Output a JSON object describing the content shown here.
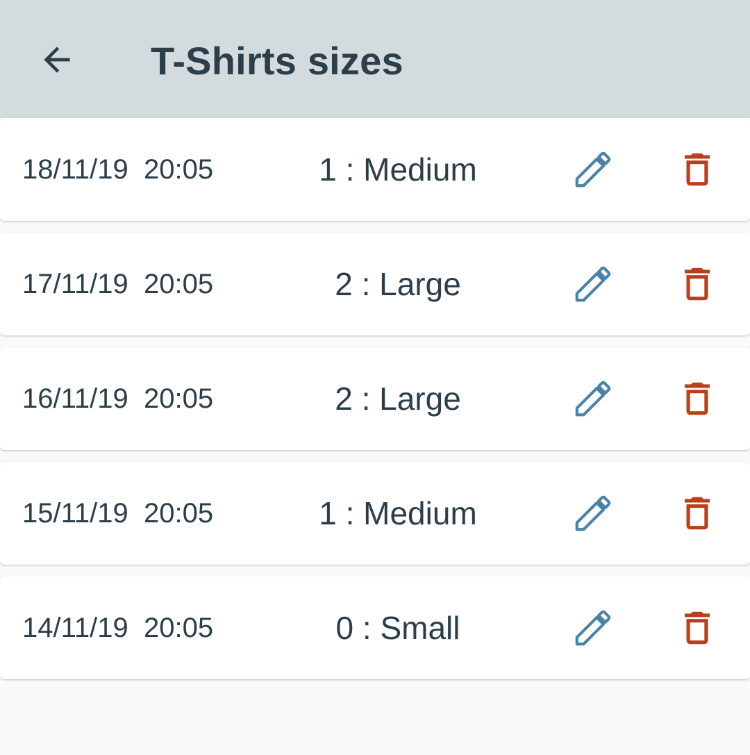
{
  "header": {
    "title": "T-Shirts sizes",
    "back_icon": "arrow-back-icon"
  },
  "colors": {
    "app_bar": "#d3dbdf",
    "text": "#2c3e4a",
    "edit_icon": "#4a82a8",
    "delete_icon": "#b8401e",
    "background": "#fafafa"
  },
  "entries": [
    {
      "date": "18/11/19  20:05",
      "size": "1 : Medium",
      "edit_icon": "pencil-icon",
      "delete_icon": "trash-icon"
    },
    {
      "date": "17/11/19  20:05",
      "size": "2 : Large",
      "edit_icon": "pencil-icon",
      "delete_icon": "trash-icon"
    },
    {
      "date": "16/11/19  20:05",
      "size": "2 : Large",
      "edit_icon": "pencil-icon",
      "delete_icon": "trash-icon"
    },
    {
      "date": "15/11/19  20:05",
      "size": "1 : Medium",
      "edit_icon": "pencil-icon",
      "delete_icon": "trash-icon"
    },
    {
      "date": "14/11/19  20:05",
      "size": "0 : Small",
      "edit_icon": "pencil-icon",
      "delete_icon": "trash-icon"
    }
  ]
}
